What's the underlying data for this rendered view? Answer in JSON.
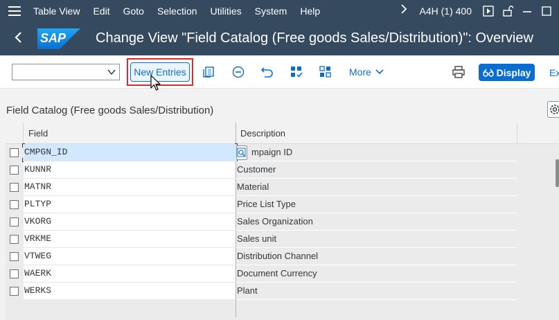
{
  "menubar": {
    "items": [
      "Table View",
      "Edit",
      "Goto",
      "Selection",
      "Utilities",
      "System",
      "Help"
    ],
    "system_info": "A4H (1) 400",
    "icons": [
      "hamburger-icon",
      "chevron-right-icon",
      "execute-icon",
      "unlock-icon",
      "minimize-icon",
      "maximize-icon"
    ]
  },
  "titlebar": {
    "logo_text": "SAP",
    "title": "Change View \"Field Catalog (Free goods Sales/Distribution)\": Overview"
  },
  "toolbar": {
    "combo_value": "",
    "new_entries_label": "New Entries",
    "more_label": "More",
    "display_label": "Display",
    "exit_label": "Ex"
  },
  "table": {
    "section_title": "Field Catalog (Free goods Sales/Distribution)",
    "columns": [
      "Field",
      "Description"
    ],
    "rows": [
      {
        "field": "CMPGN_ID",
        "description": "mpaign ID"
      },
      {
        "field": "KUNNR",
        "description": "Customer"
      },
      {
        "field": "MATNR",
        "description": "Material"
      },
      {
        "field": "PLTYP",
        "description": "Price List Type"
      },
      {
        "field": "VKORG",
        "description": "Sales Organization"
      },
      {
        "field": "VRKME",
        "description": "Sales unit"
      },
      {
        "field": "VTWEG",
        "description": "Distribution Channel"
      },
      {
        "field": "WAERK",
        "description": "Document Currency"
      },
      {
        "field": "WERKS",
        "description": "Plant"
      }
    ]
  },
  "colors": {
    "shell": "#354a5f",
    "accent": "#0a6ed1",
    "highlight_box": "#e0262f",
    "selected_cell": "#d1e8ff"
  }
}
